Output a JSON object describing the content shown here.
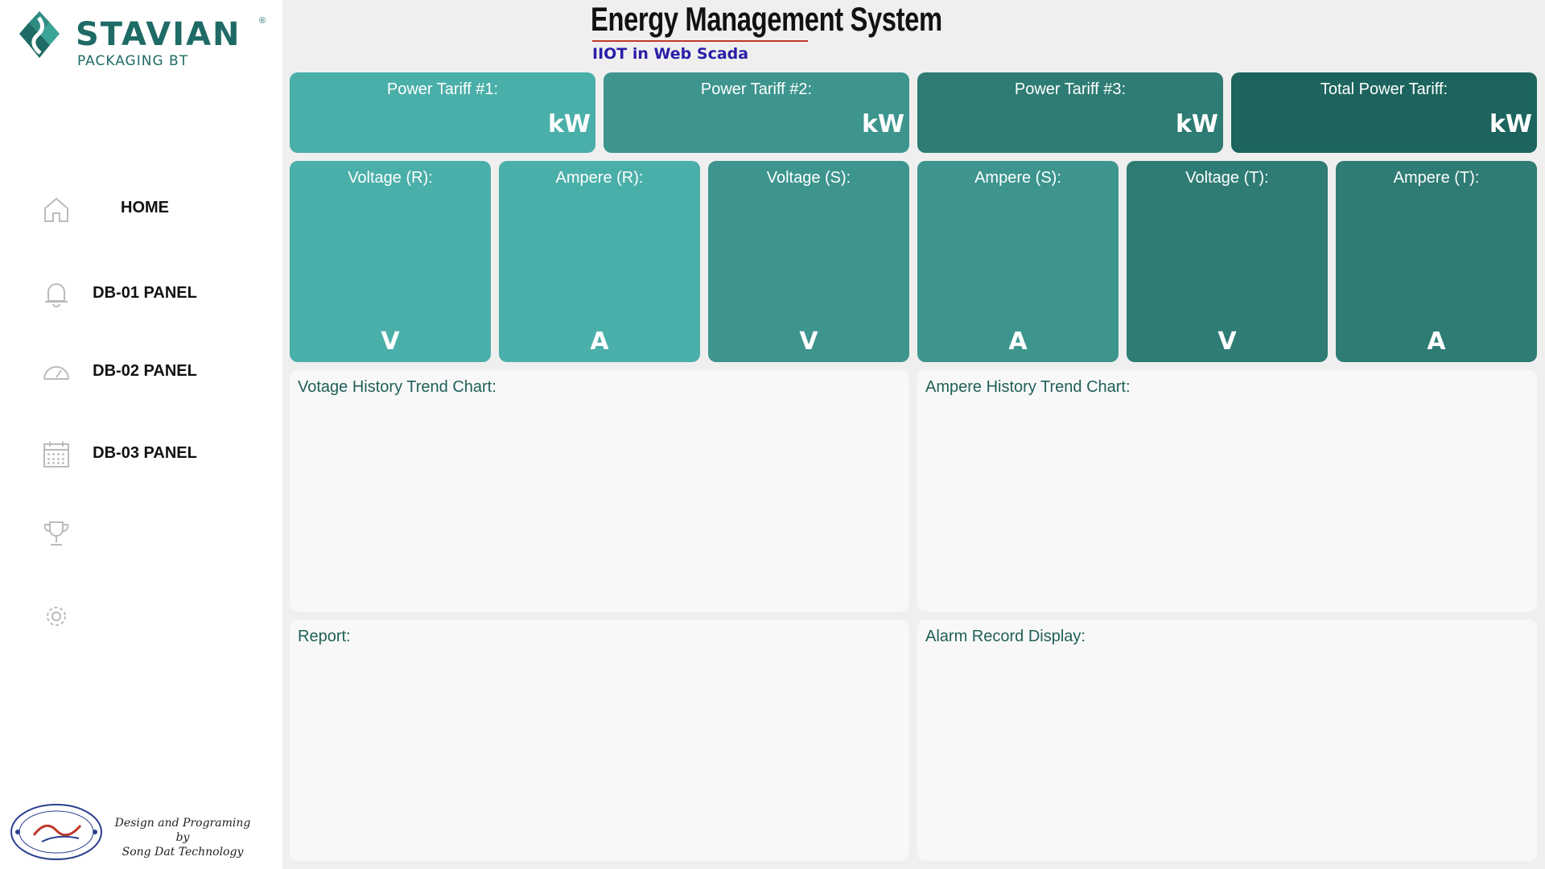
{
  "brand": {
    "name": "STAVIAN",
    "registered": "®",
    "sub": "PACKAGING BT",
    "color": "#1e6b66"
  },
  "header": {
    "title": "Energy Management System",
    "subtitle": "IIOT in Web Scada"
  },
  "sidebar": {
    "items": [
      {
        "label": "HOME",
        "icon": "home-icon"
      },
      {
        "label": "DB-01 PANEL",
        "icon": "bell-icon"
      },
      {
        "label": "DB-02 PANEL",
        "icon": "gauge-icon"
      },
      {
        "label": "DB-03 PANEL",
        "icon": "calendar-icon"
      },
      {
        "label": "",
        "icon": "trophy-icon"
      },
      {
        "label": "",
        "icon": "gear-icon"
      }
    ],
    "credit_line1": "Design and Programing by",
    "credit_line2": "Song Dat Technology"
  },
  "tariffs": [
    {
      "label": "Power Tariff #1:",
      "unit": "kW",
      "color": "#4aafa9"
    },
    {
      "label": "Power Tariff #2:",
      "unit": "kW",
      "color": "#3d958e"
    },
    {
      "label": "Power Tariff #3:",
      "unit": "kW",
      "color": "#2e7c74"
    },
    {
      "label": "Total Power Tariff:",
      "unit": "kW",
      "color": "#1c645d"
    }
  ],
  "phases": [
    {
      "label": "Voltage (R):",
      "unit": "V",
      "color": "#4aafa9"
    },
    {
      "label": "Ampere (R):",
      "unit": "A",
      "color": "#4aafa9"
    },
    {
      "label": "Voltage (S):",
      "unit": "V",
      "color": "#3d958e"
    },
    {
      "label": "Ampere (S):",
      "unit": "A",
      "color": "#3d958e"
    },
    {
      "label": "Voltage (T):",
      "unit": "V",
      "color": "#2e7c74"
    },
    {
      "label": "Ampere (T):",
      "unit": "A",
      "color": "#2e7c74"
    }
  ],
  "panels": {
    "voltage_chart": "Votage History Trend Chart:",
    "ampere_chart": "Ampere History Trend Chart:",
    "report": "Report:",
    "alarm": "Alarm Record Display:"
  }
}
